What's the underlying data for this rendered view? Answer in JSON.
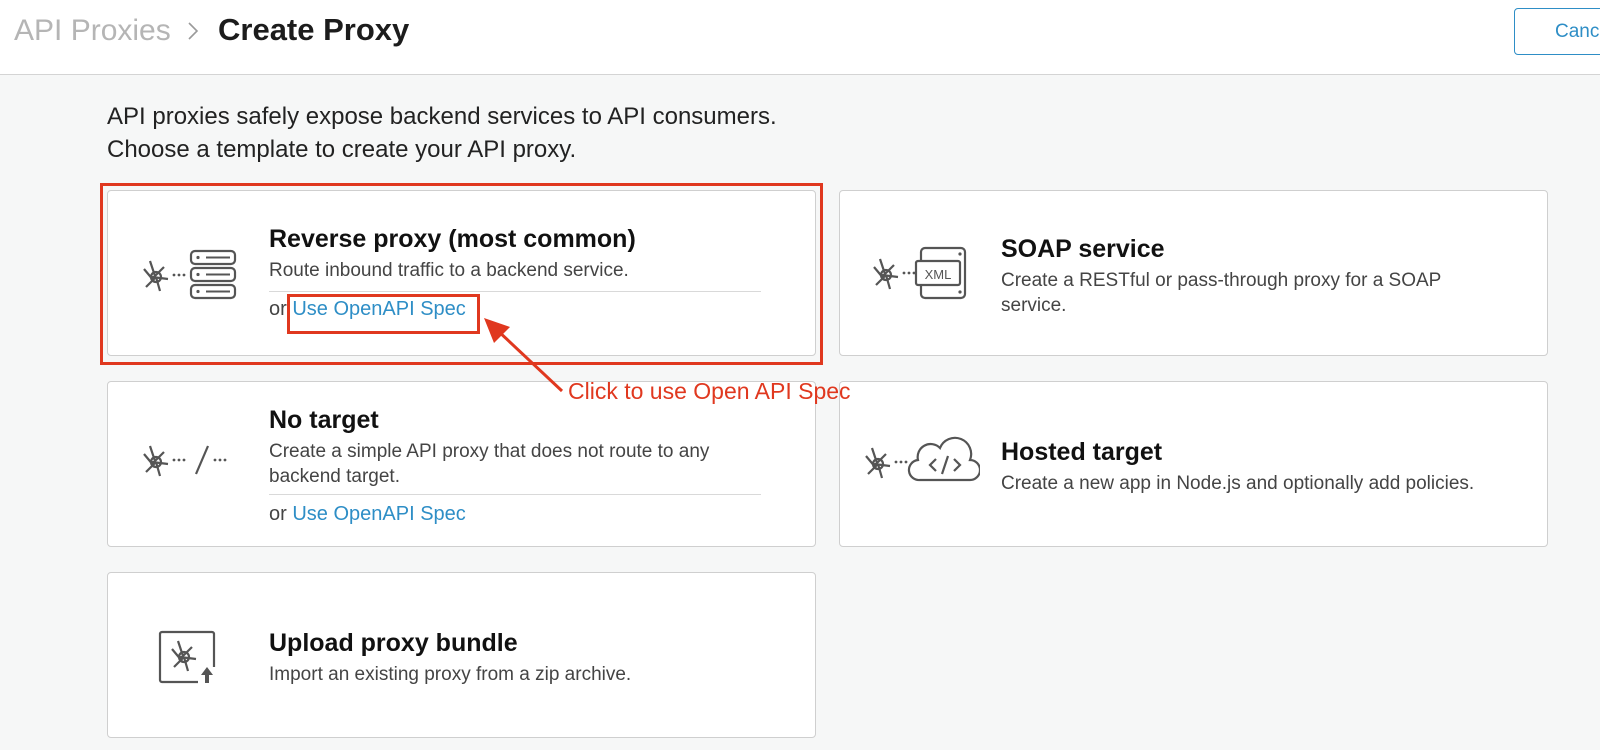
{
  "header": {
    "breadcrumb_root": "API Proxies",
    "breadcrumb_current": "Create Proxy",
    "cancel_label": "Canc"
  },
  "intro": {
    "line1": "API proxies safely expose backend services to API consumers.",
    "line2": "Choose a template to create your API proxy."
  },
  "cards": {
    "reverse": {
      "title": "Reverse proxy (most common)",
      "desc": "Route inbound traffic to a backend service.",
      "or": "or",
      "link": "Use OpenAPI Spec",
      "icon": "reverse-proxy-icon"
    },
    "soap": {
      "title": "SOAP service",
      "desc": "Create a RESTful or pass-through proxy for a SOAP service.",
      "icon": "soap-service-icon",
      "icon_text": "XML"
    },
    "notarget": {
      "title": "No target",
      "desc": "Create a simple API proxy that does not route to any backend target.",
      "or": "or",
      "link": "Use OpenAPI Spec",
      "icon": "no-target-icon"
    },
    "hosted": {
      "title": "Hosted target",
      "desc": "Create a new app in Node.js and optionally add policies.",
      "icon": "hosted-target-icon"
    },
    "upload": {
      "title": "Upload proxy bundle",
      "desc": "Import an existing proxy from a zip archive.",
      "icon": "upload-bundle-icon"
    }
  },
  "annotation": {
    "text": "Click to use Open API Spec",
    "color": "#e0381f"
  },
  "colors": {
    "link": "#2e8ec6",
    "highlight": "#e0381f",
    "background": "#f6f7f7"
  }
}
